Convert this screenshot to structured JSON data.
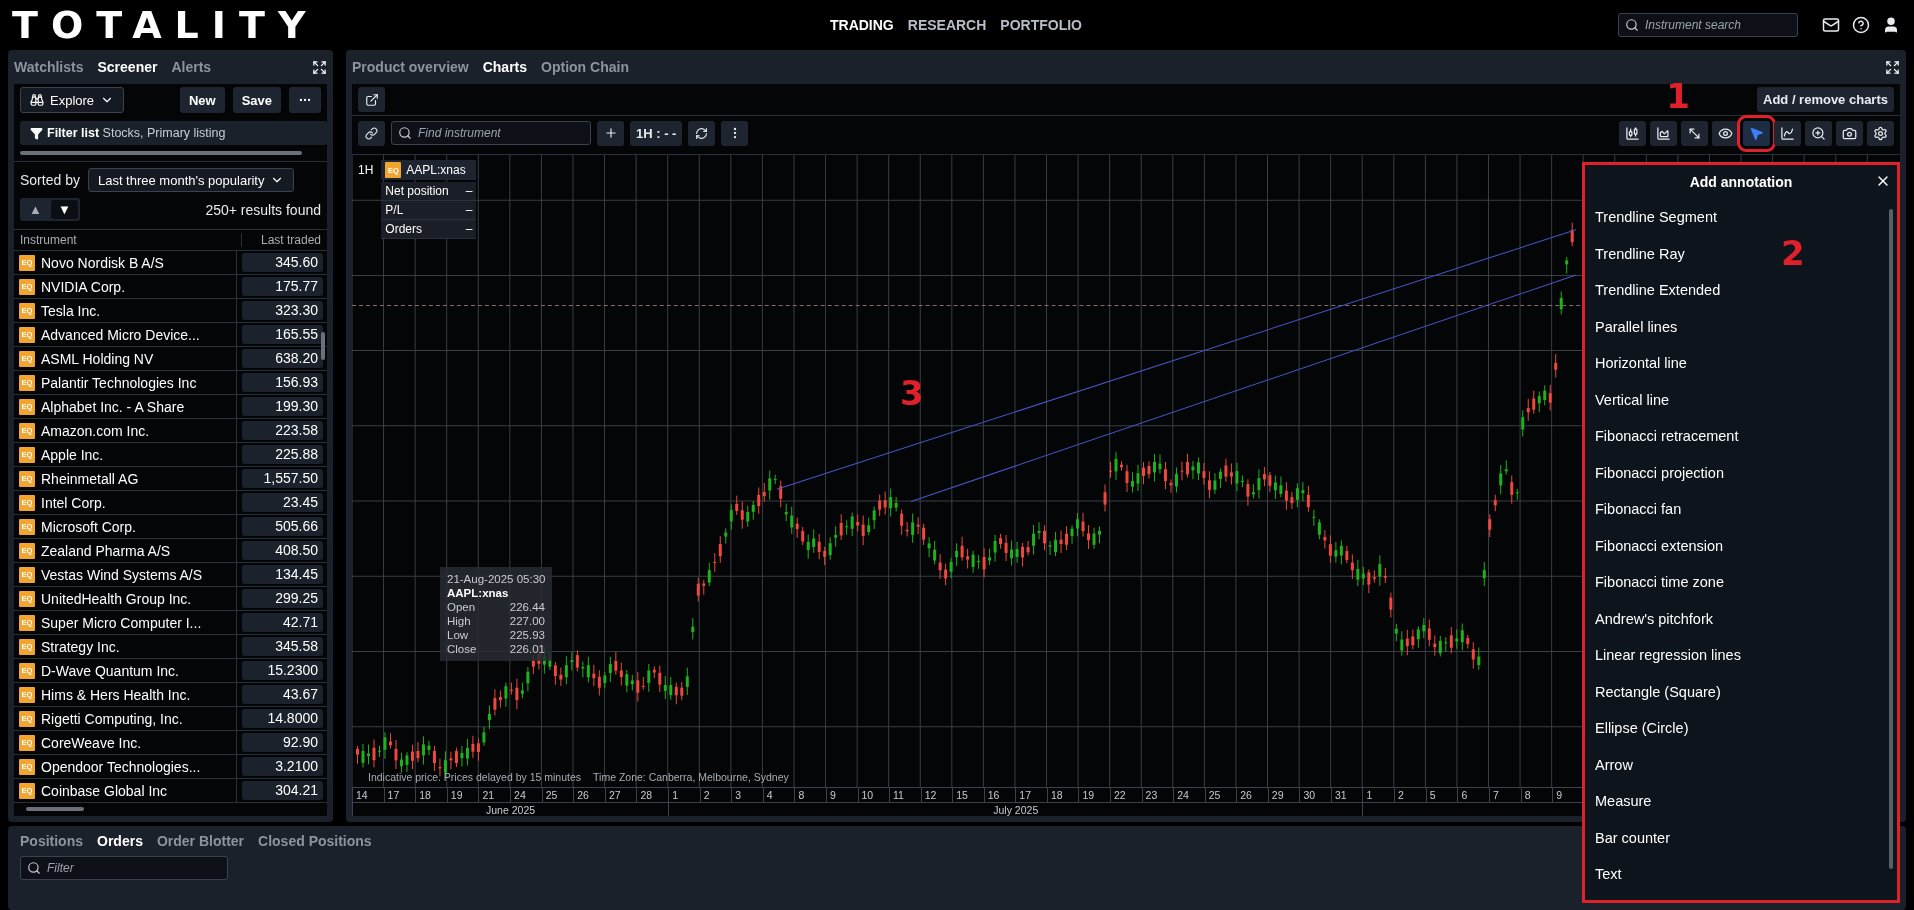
{
  "header": {
    "logo": "TOTALITY",
    "nav": [
      {
        "label": "TRADING",
        "selected": true
      },
      {
        "label": "RESEARCH",
        "selected": false
      },
      {
        "label": "PORTFOLIO",
        "selected": false
      }
    ],
    "search": {
      "placeholder": "Instrument search"
    }
  },
  "screener": {
    "tabs": [
      {
        "label": "Watchlists",
        "selected": false
      },
      {
        "label": "Screener",
        "selected": true
      },
      {
        "label": "Alerts",
        "selected": false
      }
    ],
    "explore": "Explore",
    "buttons": [
      "New",
      "Save"
    ],
    "filter": "**Filter list** Stocks, Primary listing",
    "sort_label": "Sorted by",
    "sort_value": "Last three month's popularity",
    "sort_directions": [
      {
        "glyph": "▲",
        "selected": false
      },
      {
        "glyph": "▼",
        "selected": true
      }
    ],
    "results": "250+ results found",
    "columns": [
      "Instrument",
      "Last traded"
    ],
    "rows": [
      {
        "type": "EQ",
        "name": "Novo Nordisk B A/S",
        "price": "345.60"
      },
      {
        "type": "EQ",
        "name": "NVIDIA Corp.",
        "price": "175.77"
      },
      {
        "type": "EQ",
        "name": "Tesla Inc.",
        "price": "323.30"
      },
      {
        "type": "EQ",
        "name": "Advanced Micro Device...",
        "price": "165.55"
      },
      {
        "type": "EQ",
        "name": "ASML Holding NV",
        "price": "638.20"
      },
      {
        "type": "EQ",
        "name": "Palantir Technologies Inc",
        "price": "156.93"
      },
      {
        "type": "EQ",
        "name": "Alphabet Inc. - A Share",
        "price": "199.30"
      },
      {
        "type": "EQ",
        "name": "Amazon.com Inc.",
        "price": "223.58"
      },
      {
        "type": "EQ",
        "name": "Apple Inc.",
        "price": "225.88"
      },
      {
        "type": "EQ",
        "name": "Rheinmetall AG",
        "price": "1,557.50"
      },
      {
        "type": "EQ",
        "name": "Intel Corp.",
        "price": "23.45"
      },
      {
        "type": "EQ",
        "name": "Microsoft Corp.",
        "price": "505.66"
      },
      {
        "type": "EQ",
        "name": "Zealand Pharma A/S",
        "price": "408.50"
      },
      {
        "type": "EQ",
        "name": "Vestas Wind Systems A/S",
        "price": "134.45"
      },
      {
        "type": "EQ",
        "name": "UnitedHealth Group Inc.",
        "price": "299.25"
      },
      {
        "type": "EQ",
        "name": "Super Micro Computer I...",
        "price": "42.71"
      },
      {
        "type": "EQ",
        "name": "Strategy Inc.",
        "price": "345.58"
      },
      {
        "type": "EQ",
        "name": "D-Wave Quantum Inc.",
        "price": "15.2300"
      },
      {
        "type": "EQ",
        "name": "Hims & Hers Health Inc.",
        "price": "43.67"
      },
      {
        "type": "EQ",
        "name": "Rigetti Computing, Inc.",
        "price": "14.8000"
      },
      {
        "type": "EQ",
        "name": "CoreWeave Inc.",
        "price": "92.90"
      },
      {
        "type": "EQ",
        "name": "Opendoor Technologies...",
        "price": "3.2100"
      },
      {
        "type": "EQ",
        "name": "Coinbase Global Inc",
        "price": "304.21"
      }
    ]
  },
  "chart_panel": {
    "tabs": [
      {
        "label": "Product overview",
        "selected": false
      },
      {
        "label": "Charts",
        "selected": true
      },
      {
        "label": "Option Chain",
        "selected": false
      }
    ],
    "add_remove": "Add / remove charts",
    "find": {
      "placeholder": "Find instrument"
    },
    "interval": "1H : - -",
    "tools": [
      {
        "kind": "candles",
        "selected": false,
        "marked": false
      },
      {
        "kind": "area",
        "selected": false,
        "marked": false
      },
      {
        "kind": "diagonal",
        "selected": false,
        "marked": false
      },
      {
        "kind": "eye",
        "selected": false,
        "marked": false
      },
      {
        "kind": "pointer",
        "selected": true,
        "marked": true
      },
      {
        "kind": "curve",
        "selected": false,
        "marked": false
      },
      {
        "kind": "zoom",
        "selected": false,
        "marked": false
      },
      {
        "kind": "camera",
        "selected": false,
        "marked": false
      },
      {
        "kind": "settings",
        "selected": false,
        "marked": false
      }
    ],
    "callout": "1",
    "chart": {
      "interval": "1H",
      "instrument_type": "EQ",
      "instrument": "AAPL:xnas",
      "position": [
        {
          "label": "Net position",
          "value": "–"
        },
        {
          "label": "P/L",
          "value": "–"
        },
        {
          "label": "Orders",
          "value": "–"
        }
      ],
      "tooltip": {
        "date": "21-Aug-2025 05:30",
        "instrument": "AAPL:xnas",
        "rows": [
          {
            "label": "Open",
            "value": "226.44"
          },
          {
            "label": "High",
            "value": "227.00"
          },
          {
            "label": "Low",
            "value": "225.93"
          },
          {
            "label": "Close",
            "value": "226.01"
          }
        ]
      },
      "footnote": "Indicative price. Prices delayed by 15 minutes",
      "timezone": "Time Zone: Canberra, Melbourne, Sydney",
      "months": [
        {
          "label": "June 2025",
          "days": [
            "14",
            "17",
            "18",
            "19",
            "21",
            "24",
            "25",
            "26",
            "27",
            "28"
          ]
        },
        {
          "label": "July 2025",
          "days": [
            "1",
            "2",
            "3",
            "4",
            "8",
            "9",
            "10",
            "11",
            "12",
            "15",
            "16",
            "17",
            "18",
            "19",
            "22",
            "23",
            "24",
            "25",
            "26",
            "29",
            "30",
            "31"
          ]
        },
        {
          "days": [
            "1",
            "2",
            "5",
            "6",
            "7",
            "8",
            "9"
          ]
        }
      ],
      "callout": "3"
    }
  },
  "annotation_panel": {
    "title": "Add annotation",
    "marked": true,
    "callout": "2",
    "items": [
      "Trendline Segment",
      "Trendline Ray",
      "Trendline Extended",
      "Parallel lines",
      "Horizontal line",
      "Vertical line",
      "Fibonacci retracement",
      "Fibonacci projection",
      "Fibonacci fan",
      "Fibonacci extension",
      "Fibonacci time zone",
      "Andrew's pitchfork",
      "Linear regression lines",
      "Rectangle (Square)",
      "Ellipse (Circle)",
      "Arrow",
      "Measure",
      "Bar counter",
      "Text"
    ]
  },
  "bottom_panel": {
    "tabs": [
      {
        "label": "Positions",
        "selected": false
      },
      {
        "label": "Orders",
        "selected": true
      },
      {
        "label": "Order Blotter",
        "selected": false
      },
      {
        "label": "Closed Positions",
        "selected": false
      }
    ],
    "filter": {
      "placeholder": "Filter"
    }
  }
}
